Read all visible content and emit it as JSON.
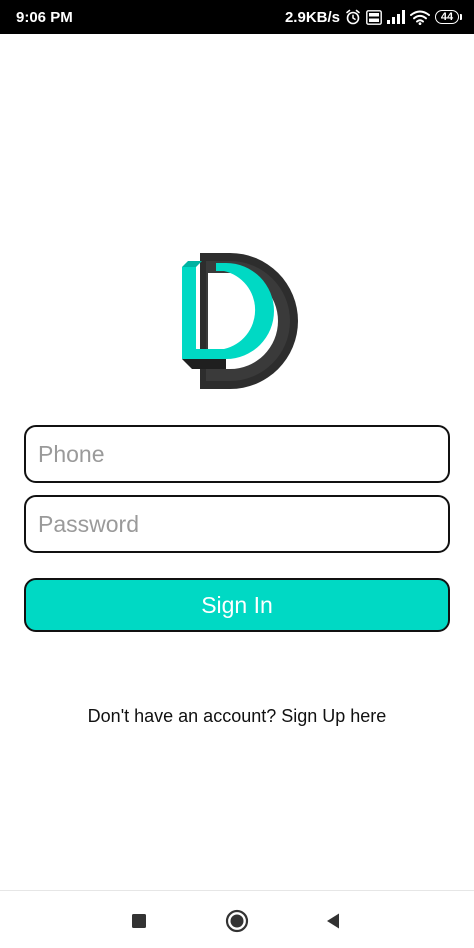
{
  "status_bar": {
    "time": "9:06 PM",
    "network_speed": "2.9KB/s",
    "battery_level": "44",
    "icons": [
      "alarm-icon",
      "volte-icon",
      "signal-icon",
      "wifi-icon",
      "battery-icon"
    ]
  },
  "logo": {
    "icon": "d-logo-icon",
    "colors": {
      "primary": "#00d9c4",
      "secondary": "#2a2a2a"
    }
  },
  "form": {
    "phone": {
      "value": "",
      "placeholder": "Phone"
    },
    "password": {
      "value": "",
      "placeholder": "Password"
    },
    "signin_label": "Sign In"
  },
  "footer": {
    "signup_text": "Don't have an account? Sign Up here"
  },
  "nav_bar": {
    "icons": [
      "recents-icon",
      "home-icon",
      "back-icon"
    ]
  },
  "colors": {
    "accent": "#00d9c4",
    "border": "#111111",
    "placeholder": "#9a9a9a"
  }
}
